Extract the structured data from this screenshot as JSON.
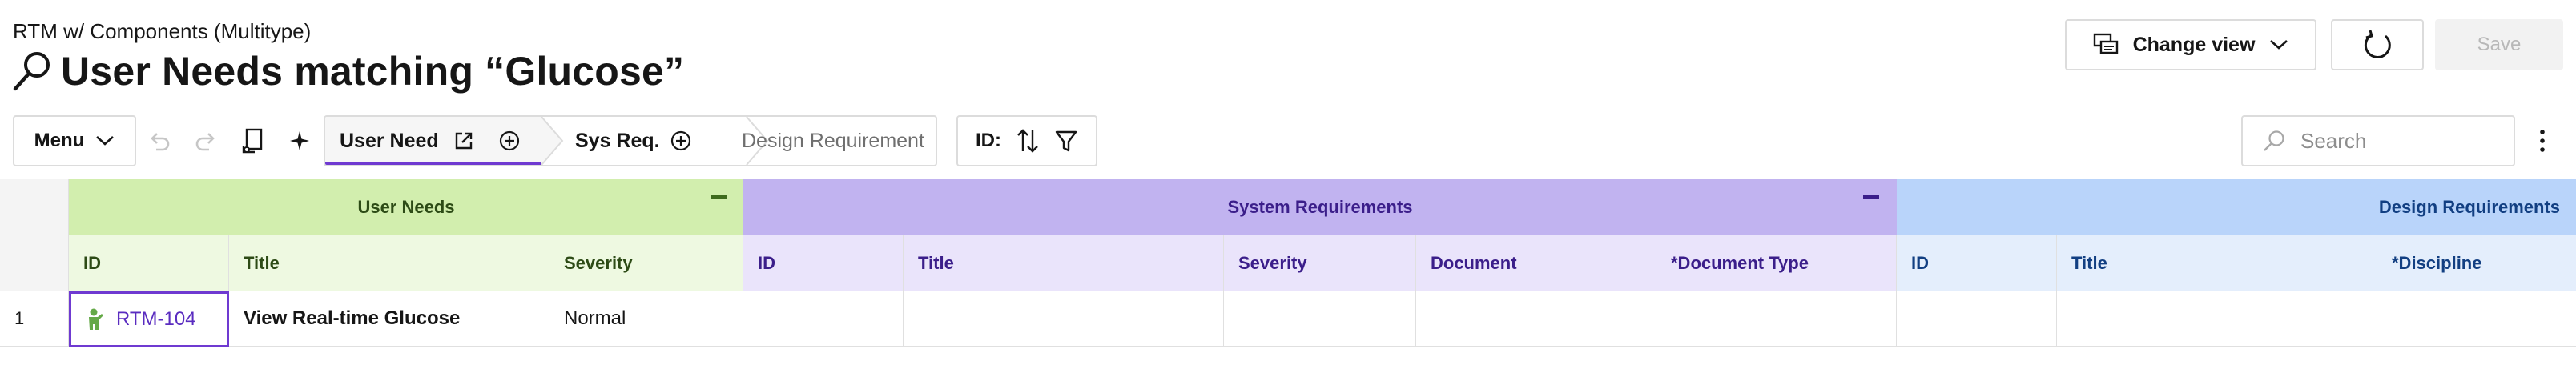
{
  "header": {
    "subtitle": "RTM w/ Components (Multitype)",
    "title": "User Needs matching “Glucose”",
    "change_view_label": "Change view",
    "save_label": "Save"
  },
  "toolbar": {
    "menu_label": "Menu",
    "breadcrumb": [
      "User Need",
      "Sys Req.",
      "Design Requirement"
    ],
    "sort_label": "ID:",
    "search_placeholder": "Search"
  },
  "grid": {
    "groups": [
      {
        "label": "User Needs",
        "color": "#d2eeae"
      },
      {
        "label": "System Requirements",
        "color": "#c1b3f0"
      },
      {
        "label": "Design Requirements",
        "color": "#b9d4fa"
      }
    ],
    "user_needs_columns": [
      "ID",
      "Title",
      "Severity"
    ],
    "system_columns": [
      "ID",
      "Title",
      "Severity",
      "Document",
      "*Document Type"
    ],
    "design_columns": [
      "ID",
      "Title",
      "*Discipline"
    ],
    "rows": [
      {
        "num": "1",
        "id": "RTM-104",
        "title": "View Real-time Glucose",
        "severity": "Normal"
      }
    ]
  },
  "colors": {
    "accent": "#6f3ad1",
    "link": "#5a2cc0",
    "user_needs_light": "#eef9e1",
    "system_light": "#eae4fb",
    "design_light": "#e4eefc",
    "user_need_icon": "#64a947"
  }
}
